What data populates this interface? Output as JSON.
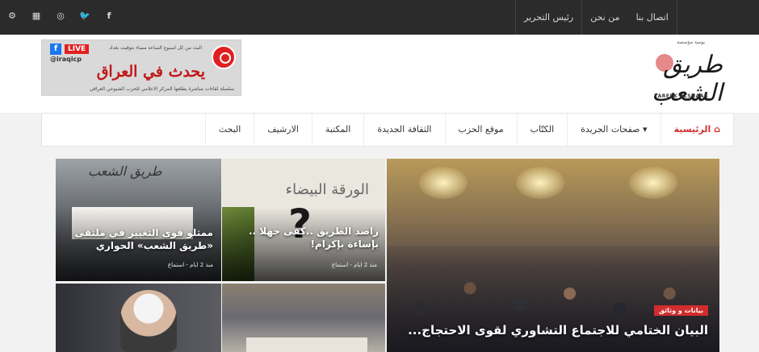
{
  "topbar": {
    "social_icons": [
      "settings-icon",
      "grid-icon",
      "instagram-icon",
      "twitter-icon",
      "facebook-icon"
    ],
    "social_glyphs": [
      "⚙",
      "▦",
      "◎",
      "🐦",
      "f"
    ],
    "links": [
      "اتصال بنا",
      "من نحن",
      "رئيس التحرير"
    ]
  },
  "banner": {
    "fb": "f",
    "live": "LIVE",
    "handle": "@iraqicp",
    "headline": "يحدث في العراق",
    "small": "البث من كل اسبوع الساعة مساء بتوقيت بغداد",
    "sub": "سلسلة لقاءات مباشرة يطلعها المركز الاعلامي للحزب الشيوعي العراقي"
  },
  "logo": {
    "small": "يومية مؤسسة",
    "mark": "طريق الشعب",
    "en": "TAREEK ALSHAAB"
  },
  "nav": {
    "items": [
      "الرئيسية",
      "صفحات الجريدة",
      "الكتّاب",
      "موقع الحزب",
      "الثقافة الجديدة",
      "المكتبة",
      "الارشيف",
      "البحث"
    ],
    "home_glyph": "⌂",
    "down_glyph": "▾"
  },
  "tiles": {
    "main": {
      "badge": "بيانات و وثائق",
      "caption": "البيان الختامي للاجتماع التشاوري لقوى الاحتجاج..."
    },
    "mid_top": {
      "brand": "الورقة البيضاء",
      "symbol": "?",
      "caption": "راصد الطريق ..كفى جهلا .. بإساءة بإكرام!",
      "meta": "منذ 2 ايام - استماع"
    },
    "left_top": {
      "brand": "طريق الشعب",
      "caption": "ممثلو قوى التغيير في ملتقى «طريق الشعب» الحواري",
      "meta": "منذ 2 ايام - استماع"
    }
  },
  "colors": {
    "accent": "#d22c2c",
    "topbar": "#2b2b2b"
  }
}
